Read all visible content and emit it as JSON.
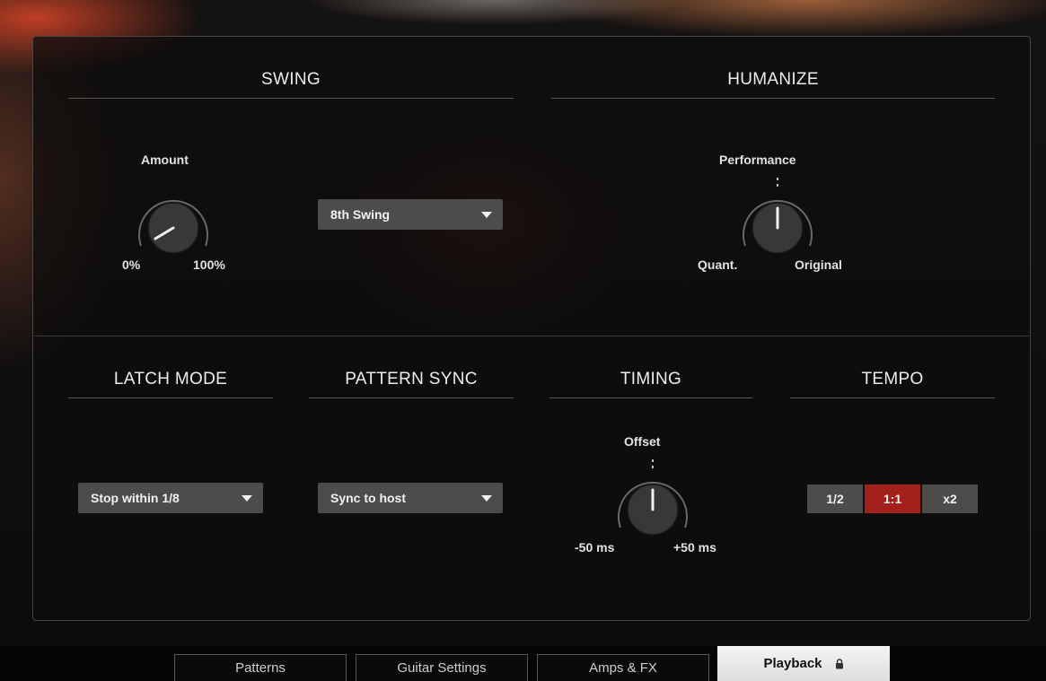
{
  "swing": {
    "title": "SWING",
    "amount_label": "Amount",
    "amount_min": "0%",
    "amount_max": "100%",
    "amount_value": 0.05,
    "type_value": "8th Swing"
  },
  "humanize": {
    "title": "HUMANIZE",
    "performance_label": "Performance",
    "min_label": "Quant.",
    "max_label": "Original",
    "performance_value": 0.5
  },
  "latch_mode": {
    "title": "LATCH MODE",
    "value": "Stop within 1/8"
  },
  "pattern_sync": {
    "title": "PATTERN SYNC",
    "value": "Sync to host"
  },
  "timing": {
    "title": "TIMING",
    "offset_label": "Offset",
    "min_label": "-50 ms",
    "max_label": "+50 ms",
    "offset_value": 0.5
  },
  "tempo": {
    "title": "TEMPO",
    "options": [
      "1/2",
      "1:1",
      "x2"
    ],
    "selected": "1:1"
  },
  "tabs": {
    "patterns": "Patterns",
    "guitar_settings": "Guitar Settings",
    "amps_fx": "Amps & FX",
    "playback": "Playback",
    "active": "Playback"
  },
  "colors": {
    "accent": "#a3201c",
    "control_bg": "#4e4c4b"
  }
}
